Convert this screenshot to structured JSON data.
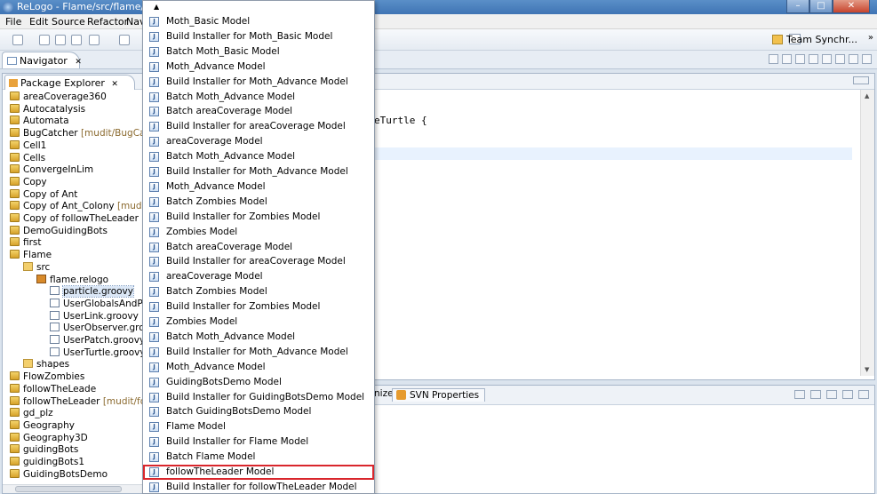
{
  "window": {
    "title": "ReLogo - Flame/src/flame/relogo/",
    "controls": [
      "–",
      "□",
      "✕"
    ]
  },
  "menubar": {
    "items": [
      "File",
      "Edit",
      "Source",
      "Refactor",
      "Navi"
    ]
  },
  "toolbar": {
    "team_sync_label": "Team Synchr...",
    "overflow": "»"
  },
  "navigator": {
    "tab_label": "Navigator",
    "close_glyph": "✕"
  },
  "package_explorer": {
    "tab_label": "Package Explorer",
    "close_glyph": "✕",
    "items": [
      {
        "label": "areaCoverage360",
        "icon": "project-icon",
        "depth": 0
      },
      {
        "label": "Autocatalysis",
        "icon": "project-icon",
        "depth": 0
      },
      {
        "label": "Automata",
        "icon": "project-icon",
        "depth": 0
      },
      {
        "label": "BugCatcher",
        "suffix": "[mudit/BugCatch",
        "icon": "project-icon",
        "depth": 0
      },
      {
        "label": "Cell1",
        "icon": "project-icon",
        "depth": 0
      },
      {
        "label": "Cells",
        "icon": "project-icon",
        "depth": 0
      },
      {
        "label": "ConvergeInLim",
        "icon": "project-icon",
        "depth": 0
      },
      {
        "label": "Copy",
        "icon": "project-icon",
        "depth": 0
      },
      {
        "label": "Copy of Ant",
        "icon": "project-icon",
        "depth": 0
      },
      {
        "label": "Copy of Ant_Colony",
        "suffix": "[mudit]",
        "icon": "project-icon",
        "depth": 0
      },
      {
        "label": "Copy of followTheLeader",
        "suffix": "[m",
        "icon": "project-icon",
        "depth": 0
      },
      {
        "label": "DemoGuidingBots",
        "icon": "project-icon",
        "depth": 0
      },
      {
        "label": "first",
        "icon": "project-icon",
        "depth": 0
      },
      {
        "label": "Flame",
        "icon": "project-icon",
        "depth": 0
      },
      {
        "label": "src",
        "icon": "folder-icon",
        "depth": 1
      },
      {
        "label": "flame.relogo",
        "icon": "package-icon",
        "depth": 2
      },
      {
        "label": "particle.groovy",
        "icon": "file-icon",
        "depth": 3,
        "selected": true
      },
      {
        "label": "UserGlobalsAndPa",
        "icon": "file-icon",
        "depth": 3
      },
      {
        "label": "UserLink.groovy",
        "icon": "file-icon",
        "depth": 3
      },
      {
        "label": "UserObserver.groo",
        "icon": "file-icon",
        "depth": 3
      },
      {
        "label": "UserPatch.groovy",
        "icon": "file-icon",
        "depth": 3
      },
      {
        "label": "UserTurtle.groovy",
        "icon": "file-icon",
        "depth": 3
      },
      {
        "label": "shapes",
        "icon": "folder-icon",
        "depth": 1
      },
      {
        "label": "FlowZombies",
        "icon": "project-icon",
        "depth": 0
      },
      {
        "label": "followTheLeade",
        "icon": "project-icon",
        "depth": 0
      },
      {
        "label": "followTheLeader",
        "suffix": "[mudit/follo",
        "icon": "project-icon",
        "depth": 0
      },
      {
        "label": "gd_plz",
        "icon": "project-icon",
        "depth": 0
      },
      {
        "label": "Geography",
        "icon": "project-icon",
        "depth": 0
      },
      {
        "label": "Geography3D",
        "icon": "project-icon",
        "depth": 0
      },
      {
        "label": "guidingBots",
        "icon": "project-icon",
        "depth": 0
      },
      {
        "label": "guidingBots1",
        "icon": "project-icon",
        "depth": 0
      },
      {
        "label": "GuidingBotsDemo",
        "icon": "project-icon",
        "depth": 0
      }
    ]
  },
  "editor": {
    "code_fragment": "eTurtle {"
  },
  "bottom_panel": {
    "tab_partial": "nize",
    "tab_svn_label": "SVN Properties"
  },
  "popup": {
    "scroll_up_glyph": "▲",
    "items": [
      {
        "label": "Moth_Basic Model"
      },
      {
        "label": "Build Installer for Moth_Basic Model"
      },
      {
        "label": "Batch Moth_Basic Model"
      },
      {
        "label": "Moth_Advance Model"
      },
      {
        "label": "Build Installer for Moth_Advance Model"
      },
      {
        "label": "Batch Moth_Advance Model"
      },
      {
        "label": "Batch areaCoverage Model"
      },
      {
        "label": "Build Installer for areaCoverage Model"
      },
      {
        "label": "areaCoverage Model"
      },
      {
        "label": "Batch Moth_Advance Model"
      },
      {
        "label": "Build Installer for Moth_Advance Model"
      },
      {
        "label": "Moth_Advance Model"
      },
      {
        "label": "Batch Zombies Model"
      },
      {
        "label": "Build Installer for Zombies Model"
      },
      {
        "label": "Zombies Model"
      },
      {
        "label": "Batch areaCoverage Model"
      },
      {
        "label": "Build Installer for areaCoverage Model"
      },
      {
        "label": "areaCoverage Model"
      },
      {
        "label": "Batch Zombies Model"
      },
      {
        "label": "Build Installer for Zombies Model"
      },
      {
        "label": "Zombies Model"
      },
      {
        "label": "Batch Moth_Advance Model"
      },
      {
        "label": "Build Installer for Moth_Advance Model"
      },
      {
        "label": "Moth_Advance Model"
      },
      {
        "label": "GuidingBotsDemo Model"
      },
      {
        "label": "Build Installer for GuidingBotsDemo Model"
      },
      {
        "label": "Batch GuidingBotsDemo Model"
      },
      {
        "label": "Flame Model"
      },
      {
        "label": "Build Installer for Flame Model"
      },
      {
        "label": "Batch Flame Model"
      },
      {
        "label": "followTheLeader Model",
        "selected": true
      },
      {
        "label": "Build Installer for followTheLeader Model"
      }
    ],
    "item_icon_glyph": "J"
  },
  "colors": {
    "selection_outline": "#d9262c",
    "titlebar": "#3f74b4"
  }
}
